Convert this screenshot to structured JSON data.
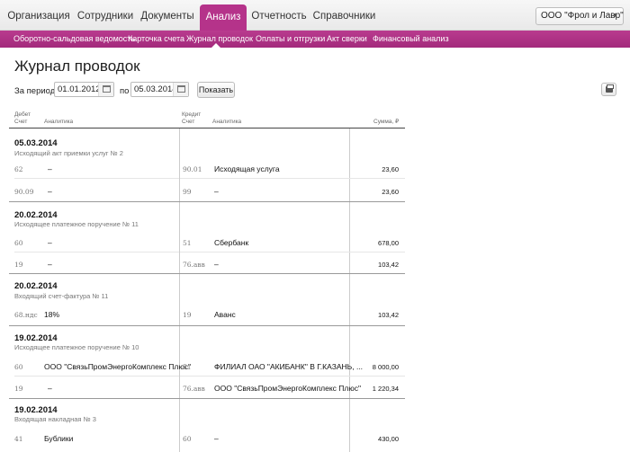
{
  "nav": {
    "tabs": [
      "Организация",
      "Сотрудники",
      "Документы",
      "Анализ",
      "Отчетность",
      "Справочники"
    ],
    "org": "ООО \"Фрол и Лавр\""
  },
  "subnav": [
    "Оборотно-сальдовая ведомость",
    "Карточка счета",
    "Журнал проводок",
    "Оплаты и отгрузки",
    "Акт сверки",
    "Финансовый анализ"
  ],
  "page": {
    "title": "Журнал проводок",
    "period_label": "За период с",
    "to_label": "по",
    "date_from": "01.01.2012",
    "date_to": "05.03.2014",
    "show_button": "Показать"
  },
  "table": {
    "debit": "Дебет",
    "account": "Счет",
    "analytics": "Аналитика",
    "credit": "Кредит",
    "account2": "Счет",
    "analytics2": "Аналитика",
    "sum": "Сумма, ₽"
  },
  "groups": [
    {
      "date": "05.03.2014",
      "doc": "Исходящий акт приемки услуг № 2",
      "rows": [
        {
          "dacc": "62",
          "dan": "–",
          "cacc": "90.01",
          "can": "Исходящая услуга",
          "sum": "23,60"
        },
        {
          "dacc": "90.09",
          "dan": "–",
          "cacc": "99",
          "can": "–",
          "sum": "23,60"
        }
      ]
    },
    {
      "date": "20.02.2014",
      "doc": "Исходящее платежное поручение № 11",
      "rows": [
        {
          "dacc": "60",
          "dan": "–",
          "cacc": "51",
          "can": "Сбербанк",
          "sum": "678,00"
        },
        {
          "dacc": "19",
          "dan": "–",
          "cacc": "76.авв",
          "can": "–",
          "sum": "103,42"
        }
      ]
    },
    {
      "date": "20.02.2014",
      "doc": "Входящий счет-фактура № 11",
      "rows": [
        {
          "dacc": "68.ндс",
          "dan": "18%",
          "cacc": "19",
          "can": "Аванс",
          "sum": "103,42"
        }
      ]
    },
    {
      "date": "19.02.2014",
      "doc": "Исходящее платежное поручение № 10",
      "rows": [
        {
          "dacc": "60",
          "dan": "ООО \"СвязьПромЭнергоКомплекс Плюс\"",
          "cacc": "51",
          "can": "ФИЛИАЛ ОАО \"АКИБАНК\" В Г.КАЗАНЬ, ...",
          "sum": "8 000,00"
        },
        {
          "dacc": "19",
          "dan": "–",
          "cacc": "76.авв",
          "can": "ООО \"СвязьПромЭнергоКомплекс Плюс\"",
          "sum": "1 220,34"
        }
      ]
    },
    {
      "date": "19.02.2014",
      "doc": "Входящая накладная № 3",
      "rows": [
        {
          "dacc": "41",
          "dan": "Бублики",
          "cacc": "60",
          "can": "–",
          "sum": "430,00"
        }
      ]
    }
  ]
}
